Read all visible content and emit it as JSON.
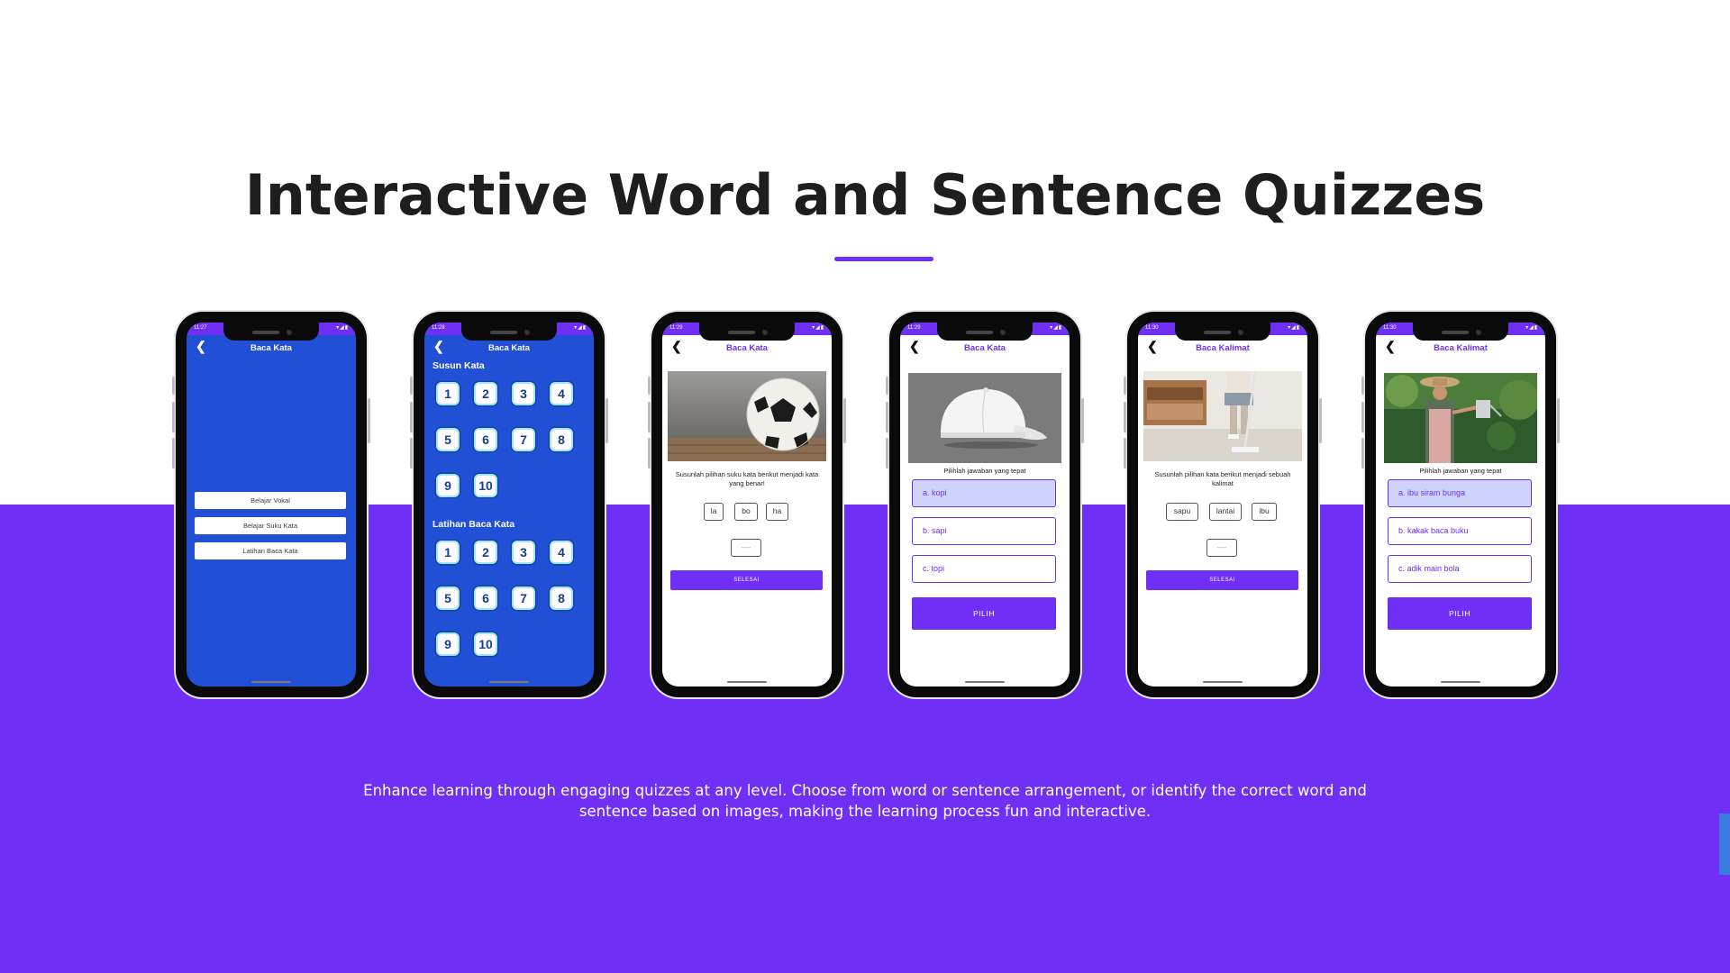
{
  "page": {
    "title": "Interactive Word and Sentence Quizzes",
    "description": "Enhance learning through engaging quizzes at any level. Choose from word or sentence arrangement, or identify the correct word and sentence based on images, making the learning process fun and interactive."
  },
  "colors": {
    "accent": "#6f2ff5",
    "app_blue": "#2150d6",
    "selected_option": "#cdd5ff"
  },
  "phones": {
    "p1": {
      "status_time": "11:27",
      "header": "Baca Kata",
      "menu": [
        "Belajar Vokal",
        "Belajar Suku Kata",
        "Latihan Baca Kata"
      ]
    },
    "p2": {
      "status_time": "11:28",
      "header": "Baca Kata",
      "section1": "Susun Kata",
      "section2": "Latihan Baca Kata",
      "numbers": [
        "1",
        "2",
        "3",
        "4",
        "5",
        "6",
        "7",
        "8",
        "9",
        "10"
      ]
    },
    "p3": {
      "status_time": "11:29",
      "header": "Baca Kata",
      "image": "soccer-ball",
      "prompt": "Susunlah pilihan suku kata berikut menjadi kata yang benar!",
      "syllables": [
        "la",
        "bo",
        "ha"
      ],
      "slot": "----",
      "button": "SELESAI"
    },
    "p4": {
      "status_time": "11:29",
      "header": "Baca Kata",
      "image": "white-cap",
      "prompt": "Pilihlah jawaban yang tepat",
      "options": [
        "a. kopi",
        "b. sapi",
        "c. topi"
      ],
      "selected_index": 0,
      "button": "PILIH"
    },
    "p5": {
      "status_time": "11:30",
      "header": "Baca Kalimat",
      "image": "sweeping-floor",
      "prompt": "Susunlah pilihan kata berikut menjadi sebuah kalimat",
      "words": [
        "sapu",
        "lantai",
        "ibu"
      ],
      "slot": "----",
      "button": "SELESAI"
    },
    "p6": {
      "status_time": "11:30",
      "header": "Baca Kalimat",
      "image": "watering-garden",
      "prompt": "Pilihlah jawaban yang tepat",
      "options": [
        "a. ibu siram bunga",
        "b. kakak baca buku",
        "c. adik main bola"
      ],
      "selected_index": 0,
      "button": "PILIH"
    }
  }
}
